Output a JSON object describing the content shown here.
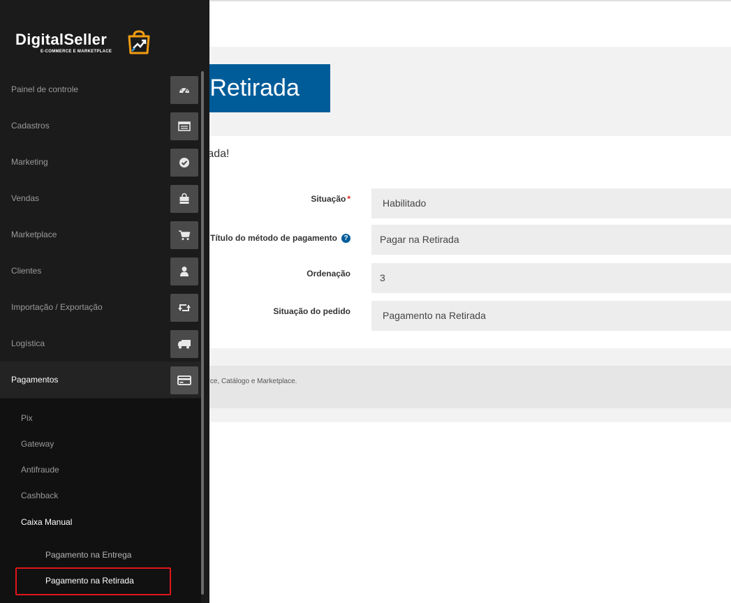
{
  "page": {
    "title": "a Retirada",
    "message": "rada!",
    "footer": "erce, Catálogo e Marketplace."
  },
  "form": {
    "fields": [
      {
        "label": "Situação",
        "required": "*",
        "value": "Habilitado"
      },
      {
        "label": "Título do método de pagamento",
        "help": "?",
        "value": "Pagar na Retirada"
      },
      {
        "label": "Ordenação",
        "value": "3"
      },
      {
        "label": "Situação do pedido",
        "value": "Pagamento na Retirada"
      }
    ]
  },
  "sidebar": {
    "logo": {
      "name": "DigitalSeller",
      "tagline": "E-COMMERCE E MARKETPLACE"
    },
    "items": [
      {
        "label": "Painel de controle",
        "icon": "dashboard-icon"
      },
      {
        "label": "Cadastros",
        "icon": "list-icon"
      },
      {
        "label": "Marketing",
        "icon": "check-circle-icon"
      },
      {
        "label": "Vendas",
        "icon": "shopping-bag-icon"
      },
      {
        "label": "Marketplace",
        "icon": "cart-icon"
      },
      {
        "label": "Clientes",
        "icon": "user-icon"
      },
      {
        "label": "Importação / Exportação",
        "icon": "retweet-icon"
      },
      {
        "label": "Logística",
        "icon": "truck-icon"
      },
      {
        "label": "Pagamentos",
        "icon": "credit-card-icon"
      }
    ],
    "submenu": [
      "Pix",
      "Gateway",
      "Antifraude",
      "Cashback",
      "Caixa Manual"
    ],
    "subsubmenu": [
      "Pagamento na Entrega",
      "Pagamento na Retirada"
    ]
  },
  "colors": {
    "sidebar_bg": "#1b1b1b",
    "accent_blue": "#005c99",
    "highlight_red": "#e2161b"
  }
}
